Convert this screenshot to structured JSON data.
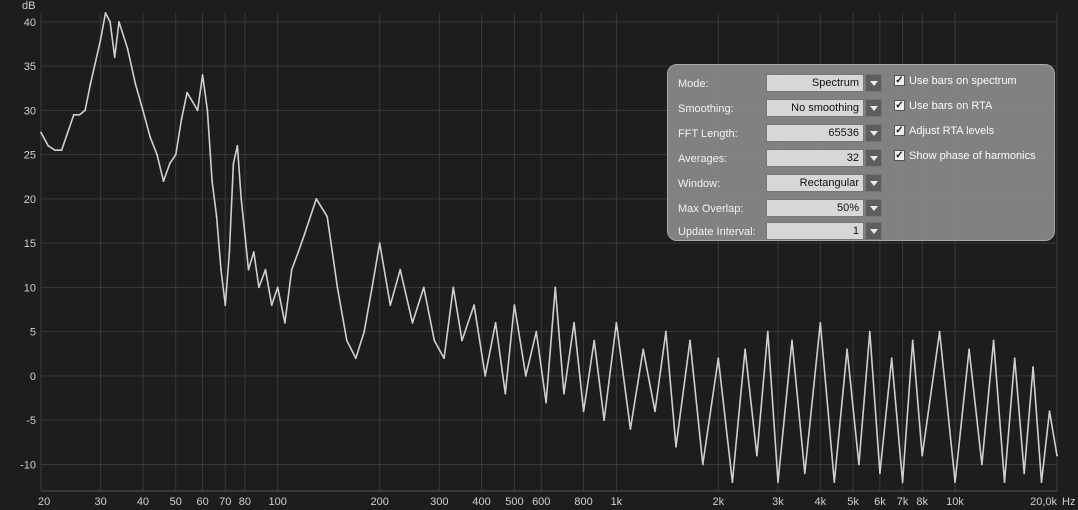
{
  "chart_data": {
    "type": "line",
    "ylabel": "dB",
    "xunit": "Hz",
    "xscale": "log",
    "xlim": [
      20,
      20000
    ],
    "ylim": [
      -13,
      41
    ],
    "grid": true,
    "yticks": [
      "40",
      "35",
      "30",
      "25",
      "20",
      "15",
      "10",
      "5",
      "0",
      "-5",
      "-10"
    ],
    "xticks": [
      {
        "v": 20,
        "label": "20"
      },
      {
        "v": 30,
        "label": "30"
      },
      {
        "v": 40,
        "label": "40"
      },
      {
        "v": 50,
        "label": "50"
      },
      {
        "v": 60,
        "label": "60"
      },
      {
        "v": 70,
        "label": "70"
      },
      {
        "v": 80,
        "label": "80"
      },
      {
        "v": 100,
        "label": "100"
      },
      {
        "v": 200,
        "label": "200"
      },
      {
        "v": 300,
        "label": "300"
      },
      {
        "v": 400,
        "label": "400"
      },
      {
        "v": 500,
        "label": "500"
      },
      {
        "v": 600,
        "label": "600"
      },
      {
        "v": 800,
        "label": "800"
      },
      {
        "v": 1000,
        "label": "1k"
      },
      {
        "v": 2000,
        "label": "2k"
      },
      {
        "v": 3000,
        "label": "3k"
      },
      {
        "v": 4000,
        "label": "4k"
      },
      {
        "v": 5000,
        "label": "5k"
      },
      {
        "v": 6000,
        "label": "6k"
      },
      {
        "v": 7000,
        "label": "7k"
      },
      {
        "v": 8000,
        "label": "8k"
      },
      {
        "v": 10000,
        "label": "10k"
      },
      {
        "v": 20000,
        "label": "20,0k"
      }
    ],
    "series": [
      {
        "color": "#cfcfcf",
        "x": [
          20,
          21,
          22,
          23,
          25,
          26,
          27,
          28,
          30,
          31,
          32,
          33,
          34,
          36,
          38,
          40,
          42,
          44,
          46,
          48,
          50,
          52,
          54,
          56,
          58,
          60,
          62,
          64,
          66,
          68,
          70,
          72,
          74,
          76,
          78,
          80,
          82,
          85,
          88,
          92,
          96,
          100,
          105,
          110,
          115,
          120,
          130,
          140,
          150,
          160,
          170,
          180,
          190,
          200,
          215,
          230,
          250,
          270,
          290,
          310,
          330,
          350,
          380,
          410,
          440,
          470,
          500,
          540,
          580,
          620,
          660,
          700,
          750,
          800,
          860,
          920,
          1000,
          1100,
          1200,
          1300,
          1400,
          1500,
          1650,
          1800,
          2000,
          2200,
          2400,
          2600,
          2800,
          3000,
          3300,
          3600,
          4000,
          4400,
          4800,
          5200,
          5600,
          6000,
          6500,
          7000,
          7500,
          8000,
          9000,
          10000,
          11000,
          12000,
          13000,
          14000,
          15000,
          16000,
          17000,
          18000,
          19000,
          20000
        ],
        "y": [
          27.5,
          26,
          25.5,
          25.5,
          29.5,
          29.5,
          30,
          33,
          38,
          41,
          40,
          36,
          40,
          37,
          33,
          30,
          27,
          25,
          22,
          24,
          25,
          29,
          32,
          31,
          30,
          34,
          30,
          22,
          18,
          12,
          8,
          14,
          24,
          26,
          20,
          16,
          12,
          14,
          10,
          12,
          8,
          10,
          6,
          12,
          14,
          16,
          20,
          18,
          10,
          4,
          2,
          5,
          10,
          15,
          8,
          12,
          6,
          10,
          4,
          2,
          10,
          4,
          8,
          0,
          6,
          -2,
          8,
          0,
          5,
          -3,
          10,
          -2,
          6,
          -4,
          4,
          -5,
          6,
          -6,
          3,
          -4,
          5,
          -8,
          4,
          -10,
          2,
          -12,
          3,
          -9,
          5,
          -12,
          4,
          -11,
          6,
          -12,
          3,
          -10,
          5,
          -11,
          2,
          -12,
          4,
          -9,
          5,
          -12,
          3,
          -10,
          4,
          -12,
          2,
          -11,
          1,
          -12,
          -4,
          -9
        ]
      }
    ]
  },
  "panel": {
    "rows": [
      {
        "label": "Mode:",
        "value": "Spectrum"
      },
      {
        "label": "Smoothing:",
        "value": "No  smoothing"
      },
      {
        "label": "FFT Length:",
        "value": "65536"
      },
      {
        "label": "Averages:",
        "value": "32"
      },
      {
        "label": "Window:",
        "value": "Rectangular"
      },
      {
        "label": "Max Overlap:",
        "value": "50%"
      },
      {
        "label": "Update Interval:",
        "value": "1"
      }
    ],
    "checks": [
      {
        "label": "Use bars on spectrum",
        "checked": true
      },
      {
        "label": "Use bars on RTA",
        "checked": true
      },
      {
        "label": "Adjust RTA levels",
        "checked": true
      },
      {
        "label": "Show phase of harmonics",
        "checked": true
      }
    ]
  }
}
